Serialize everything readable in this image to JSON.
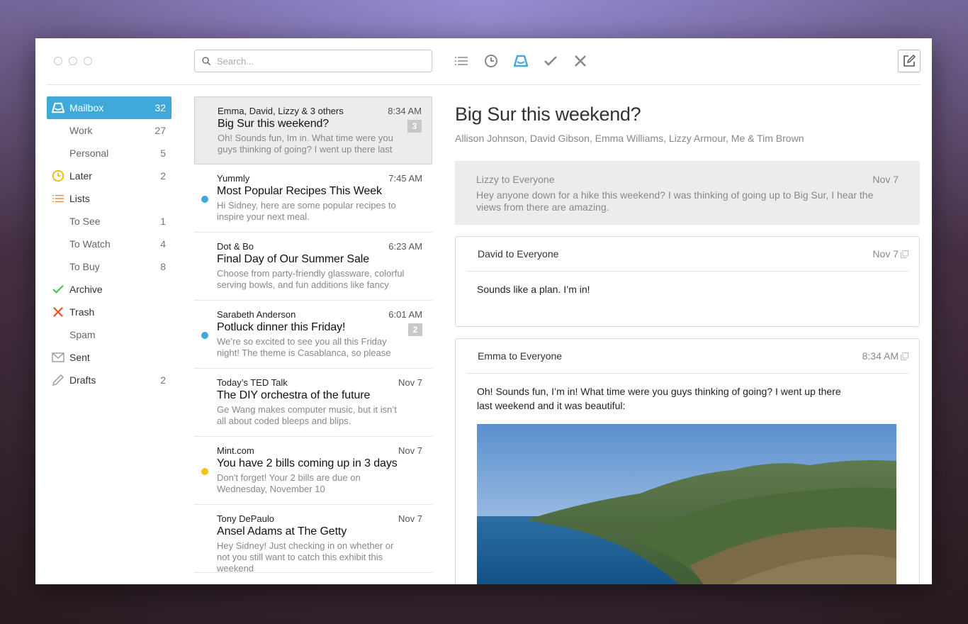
{
  "search": {
    "placeholder": "Search..."
  },
  "colors": {
    "accent": "#3fa9d9",
    "later": "#f2b705",
    "lists": "#e8873a",
    "archive": "#4cc35b",
    "trash": "#e85a2a"
  },
  "sidebar": {
    "items": [
      {
        "label": "Mailbox",
        "count": "32",
        "icon": "mailbox-icon"
      },
      {
        "label": "Work",
        "count": "27"
      },
      {
        "label": "Personal",
        "count": "5"
      },
      {
        "label": "Later",
        "count": "2",
        "icon": "clock-icon"
      },
      {
        "label": "Lists",
        "count": "",
        "icon": "list-icon"
      },
      {
        "label": "To See",
        "count": "1"
      },
      {
        "label": "To Watch",
        "count": "4"
      },
      {
        "label": "To Buy",
        "count": "8"
      },
      {
        "label": "Archive",
        "count": "",
        "icon": "checkmark-icon"
      },
      {
        "label": "Trash",
        "count": "",
        "icon": "x-icon"
      },
      {
        "label": "Spam",
        "count": ""
      },
      {
        "label": "Sent",
        "count": "",
        "icon": "envelope-icon"
      },
      {
        "label": "Drafts",
        "count": "2",
        "icon": "pencil-icon"
      }
    ]
  },
  "messages": [
    {
      "from": "Emma, David, Lizzy & 3 others",
      "time": "8:34 AM",
      "subject": "Big Sur this weekend?",
      "preview": "Oh! Sounds fun, Im in. What time were you guys thinking of going? I went up there last",
      "badge": "3",
      "dot": ""
    },
    {
      "from": "Yummly",
      "time": "7:45 AM",
      "subject": "Most Popular Recipes This Week",
      "preview": "Hi Sidney, here are some popular recipes to inspire your next meal.",
      "badge": "",
      "dot": "#3fa9d9"
    },
    {
      "from": "Dot & Bo",
      "time": "6:23 AM",
      "subject": "Final Day of Our Summer Sale",
      "preview": "Choose from party-friendly glassware, colorful serving bowls, and fun additions like fancy",
      "badge": "",
      "dot": ""
    },
    {
      "from": "Sarabeth Anderson",
      "time": "6:01 AM",
      "subject": "Potluck dinner this Friday!",
      "preview": "We’re so excited to see you all this Friday night! The theme is Casablanca, so please",
      "badge": "2",
      "dot": "#3fa9d9"
    },
    {
      "from": "Today’s TED Talk",
      "time": "Nov 7",
      "subject": "The DIY orchestra of the future",
      "preview": "Ge Wang makes computer music, but it isn’t all about coded bleeps and blips.",
      "badge": "",
      "dot": ""
    },
    {
      "from": "Mint.com",
      "time": "Nov 7",
      "subject": "You have 2 bills coming up in 3 days",
      "preview": "Don't forget! Your 2 bills are due on Wednesday, November 10",
      "badge": "",
      "dot": "#f2c40f"
    },
    {
      "from": "Tony DePaulo",
      "time": "Nov 7",
      "subject": "Ansel Adams at The Getty",
      "preview": "Hey Sidney! Just checking in on whether or not you still want to catch this exhibit this weekend",
      "badge": "",
      "dot": ""
    }
  ],
  "reader": {
    "title": "Big Sur this weekend?",
    "participants": "Allison Johnson, David Gibson, Emma Williams, Lizzy Armour, Me & Tim Brown",
    "collapsed": {
      "from": "Lizzy to Everyone",
      "date": "Nov 7",
      "preview": "Hey anyone down for a hike this weekend? I was thinking of going up to Big Sur, I hear the views from there are amazing."
    },
    "card1": {
      "from": "David to Everyone",
      "date": "Nov 7",
      "body": "Sounds like a plan. I’m in!"
    },
    "card2": {
      "from": "Emma to Everyone",
      "date": "8:34 AM",
      "body": "Oh! Sounds fun, I’m in! What time were you guys thinking of going? I went up there last weekend and it was beautiful:"
    }
  }
}
